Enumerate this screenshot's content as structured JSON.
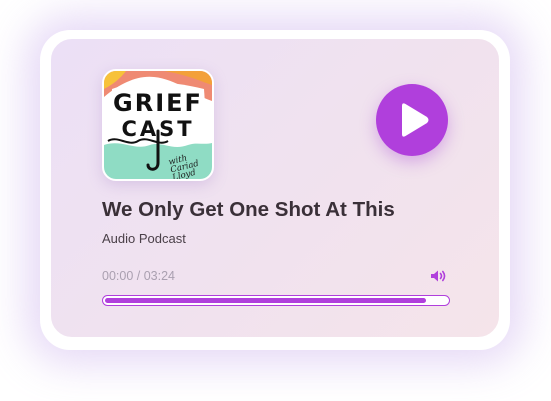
{
  "player": {
    "cover": {
      "word1": "GRIEF",
      "word2": "CAST",
      "handwriting": "with Cariad Lloyd"
    },
    "title": "We Only Get One Shot At This",
    "subtitle": "Audio Podcast",
    "time": {
      "current": "00:00",
      "separator": " / ",
      "total": "03:24"
    },
    "progress_fraction": 0.94,
    "play_icon": "play-icon",
    "volume_icon": "volume-icon"
  },
  "colors": {
    "accent": "#b03fdc",
    "title_text": "#3a3038",
    "time_text": "#aaa0b0",
    "card_bg_start": "#ece0f6",
    "card_bg_end": "#f5e4ea"
  }
}
